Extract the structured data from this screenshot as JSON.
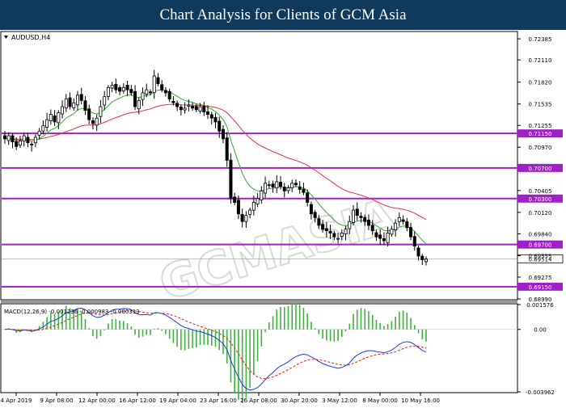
{
  "banner": {
    "title": "Chart Analysis for Clients of GCM Asia"
  },
  "chart_data": {
    "type": "candlestick",
    "symbol_label": "AUDUSD,H4",
    "watermark": "GCMASIA",
    "price_axis": {
      "range": [
        0.6899,
        0.7247
      ],
      "ticks": [
        "0.72385",
        "0.72110",
        "0.71820",
        "0.71535",
        "0.71255",
        "0.70970",
        "0.70405",
        "0.70120",
        "0.69840",
        "0.69555",
        "0.69275",
        "0.68990"
      ],
      "last_price": "0.69514"
    },
    "levels": [
      {
        "value": 0.7115,
        "label": "0.71150"
      },
      {
        "value": 0.707,
        "label": "0.70700"
      },
      {
        "value": 0.703,
        "label": "0.70300"
      },
      {
        "value": 0.697,
        "label": "0.69700"
      },
      {
        "value": 0.6915,
        "label": "0.69150"
      }
    ],
    "time_axis": {
      "labels": [
        "4 Apr 2019",
        "9 Apr 08:00",
        "12 Apr 00:00",
        "16 Apr 12:00",
        "19 Apr 04:00",
        "23 Apr 16:00",
        "26 Apr 08:00",
        "30 Apr 20:00",
        "3 May 12:00",
        "8 May 00:00",
        "10 May 16:00"
      ]
    },
    "candles_close": [
      0.7108,
      0.7112,
      0.7104,
      0.7098,
      0.7105,
      0.7112,
      0.7103,
      0.71,
      0.711,
      0.7118,
      0.7125,
      0.7133,
      0.714,
      0.713,
      0.7142,
      0.715,
      0.716,
      0.715,
      0.7155,
      0.7165,
      0.7158,
      0.7145,
      0.7133,
      0.7128,
      0.7135,
      0.715,
      0.7163,
      0.7175,
      0.7178,
      0.7172,
      0.717,
      0.7175,
      0.7172,
      0.7168,
      0.715,
      0.7158,
      0.7168,
      0.7172,
      0.7168,
      0.719,
      0.718,
      0.7172,
      0.7168,
      0.716,
      0.7155,
      0.715,
      0.7146,
      0.7148,
      0.7152,
      0.7148,
      0.7146,
      0.715,
      0.7143,
      0.714,
      0.7135,
      0.713,
      0.7118,
      0.7108,
      0.708,
      0.703,
      0.7025,
      0.701,
      0.7,
      0.7008,
      0.7015,
      0.7025,
      0.703,
      0.704,
      0.705,
      0.7048,
      0.7045,
      0.7052,
      0.7046,
      0.704,
      0.7044,
      0.705,
      0.7048,
      0.7042,
      0.7038,
      0.7025,
      0.701,
      0.7005,
      0.6995,
      0.699,
      0.6988,
      0.6985,
      0.698,
      0.6978,
      0.6985,
      0.699,
      0.7,
      0.7015,
      0.7008,
      0.7005,
      0.7,
      0.6995,
      0.6988,
      0.698,
      0.6978,
      0.6975,
      0.6985,
      0.699,
      0.6998,
      0.7005,
      0.7,
      0.6992,
      0.698,
      0.6968,
      0.6955,
      0.695,
      0.6951
    ],
    "indicator": {
      "label": "MACD(12,26,9) -0.001236 -0.000983 -0.000313",
      "axis_ticks": [
        "0.001576",
        "0.00",
        "-0.003962"
      ],
      "range": [
        -0.003962,
        0.001576
      ]
    }
  }
}
